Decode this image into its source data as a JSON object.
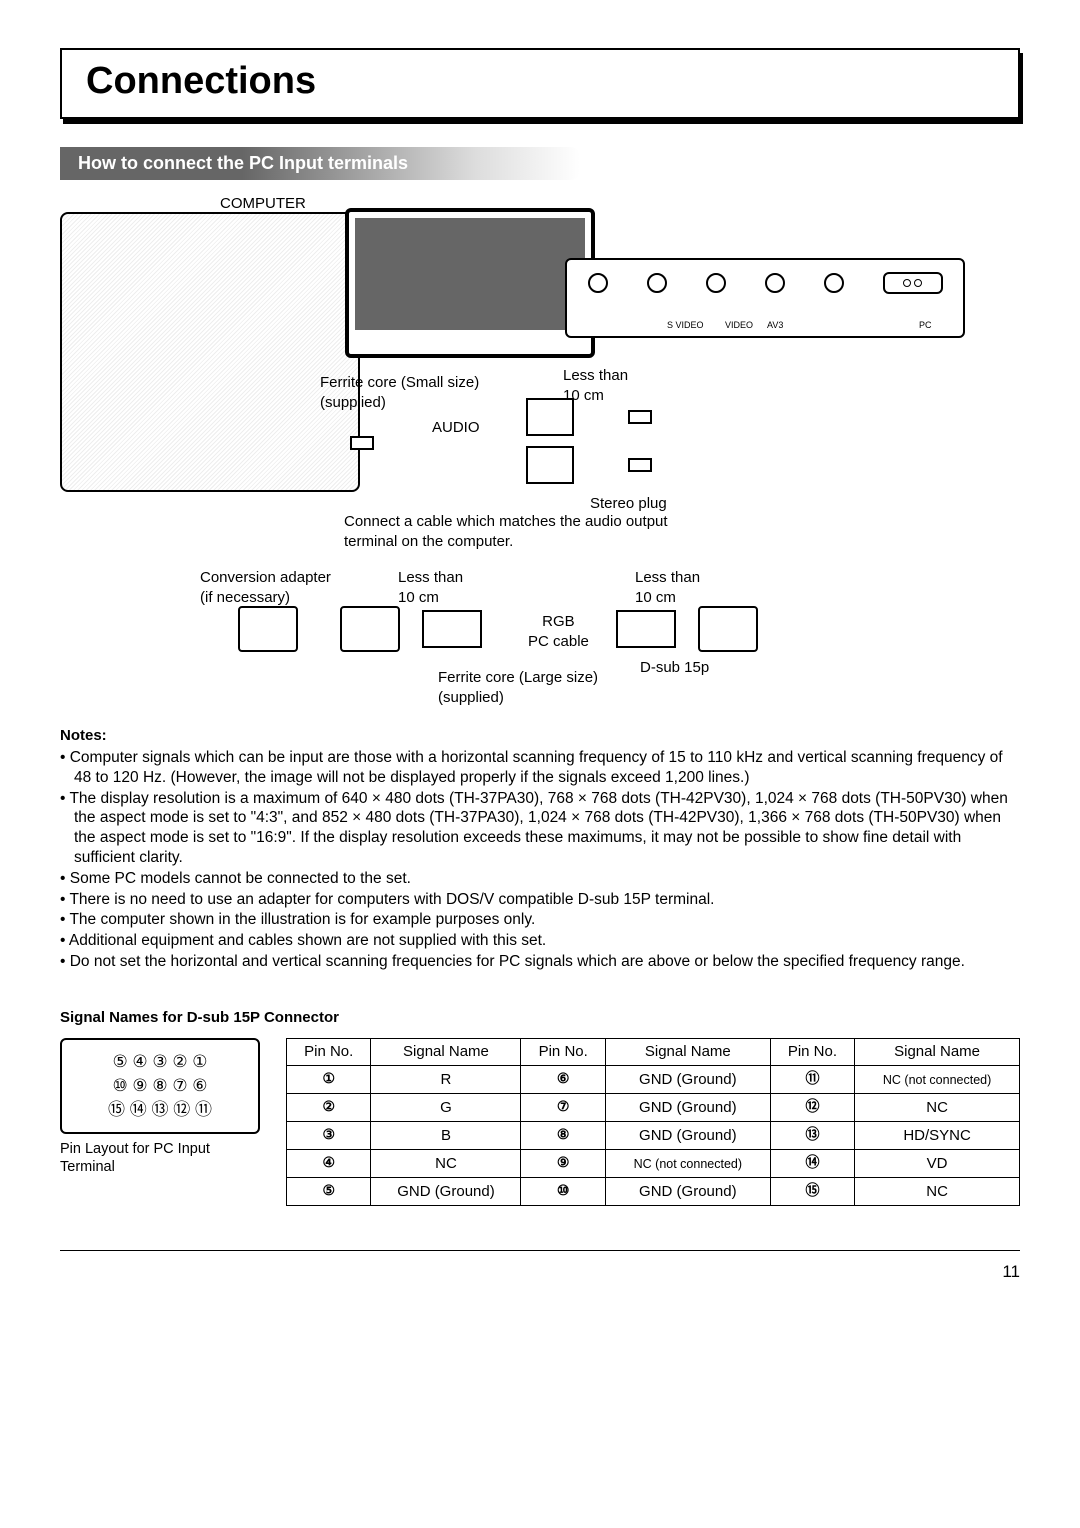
{
  "title": "Connections",
  "subhead": "How to connect the PC Input terminals",
  "diagram": {
    "computer_label": "COMPUTER",
    "ferrite_small": "Ferrite core (Small size)\n(supplied)",
    "less_than_10cm": "Less than\n10 cm",
    "audio": "AUDIO",
    "stereo_plug": "Stereo plug",
    "connect_cable": "Connect a cable which matches the audio output terminal on the computer.",
    "conversion_adapter": "Conversion adapter\n(if necessary)",
    "rgb_pc_cable": "RGB\nPC cable",
    "dsub15p": "D-sub 15p",
    "ferrite_large": "Ferrite core (Large size)\n(supplied)",
    "port_labels": {
      "svideo": "S VIDEO",
      "video": "VIDEO",
      "av3": "AV3",
      "pc": "PC"
    }
  },
  "notes_heading": "Notes:",
  "notes": [
    "Computer signals which can be input are those with a horizontal scanning frequency of 15 to 110 kHz and vertical scanning frequency of 48 to 120 Hz. (However, the image will not be displayed properly if the signals exceed 1,200 lines.)",
    "The display resolution is a maximum of 640 × 480 dots (TH-37PA30), 768 × 768 dots (TH-42PV30), 1,024 × 768 dots (TH-50PV30) when the aspect mode is set to \"4:3\", and 852 × 480 dots (TH-37PA30), 1,024 × 768 dots (TH-42PV30), 1,366 × 768 dots (TH-50PV30) when the aspect mode is set to \"16:9\". If the display resolution exceeds these maximums, it may not be possible to  show fine detail with sufficient clarity.",
    "Some PC models cannot be connected to the set.",
    "There is no need to use an adapter for computers with DOS/V compatible D-sub 15P terminal.",
    "The computer shown in the illustration is for example purposes only.",
    "Additional equipment and cables shown are not supplied with this set.",
    "Do not set the horizontal and vertical scanning frequencies for PC signals which are above or below the specified frequency range."
  ],
  "sig_heading": "Signal Names for D-sub 15P Connector",
  "pin_layout_rows": [
    "⑤ ④ ③ ② ①",
    "⑩ ⑨ ⑧ ⑦ ⑥",
    "⑮ ⑭ ⑬ ⑫ ⑪"
  ],
  "pin_caption": "Pin Layout for PC Input Terminal",
  "table": {
    "headers": [
      "Pin No.",
      "Signal Name",
      "Pin No.",
      "Signal Name",
      "Pin No.",
      "Signal Name"
    ],
    "rows": [
      [
        "①",
        "R",
        "⑥",
        "GND (Ground)",
        "⑪",
        "NC (not connected)"
      ],
      [
        "②",
        "G",
        "⑦",
        "GND (Ground)",
        "⑫",
        "NC"
      ],
      [
        "③",
        "B",
        "⑧",
        "GND (Ground)",
        "⑬",
        "HD/SYNC"
      ],
      [
        "④",
        "NC",
        "⑨",
        "NC (not connected)",
        "⑭",
        "VD"
      ],
      [
        "⑤",
        "GND (Ground)",
        "⑩",
        "GND (Ground)",
        "⑮",
        "NC"
      ]
    ]
  },
  "page_number": "11"
}
